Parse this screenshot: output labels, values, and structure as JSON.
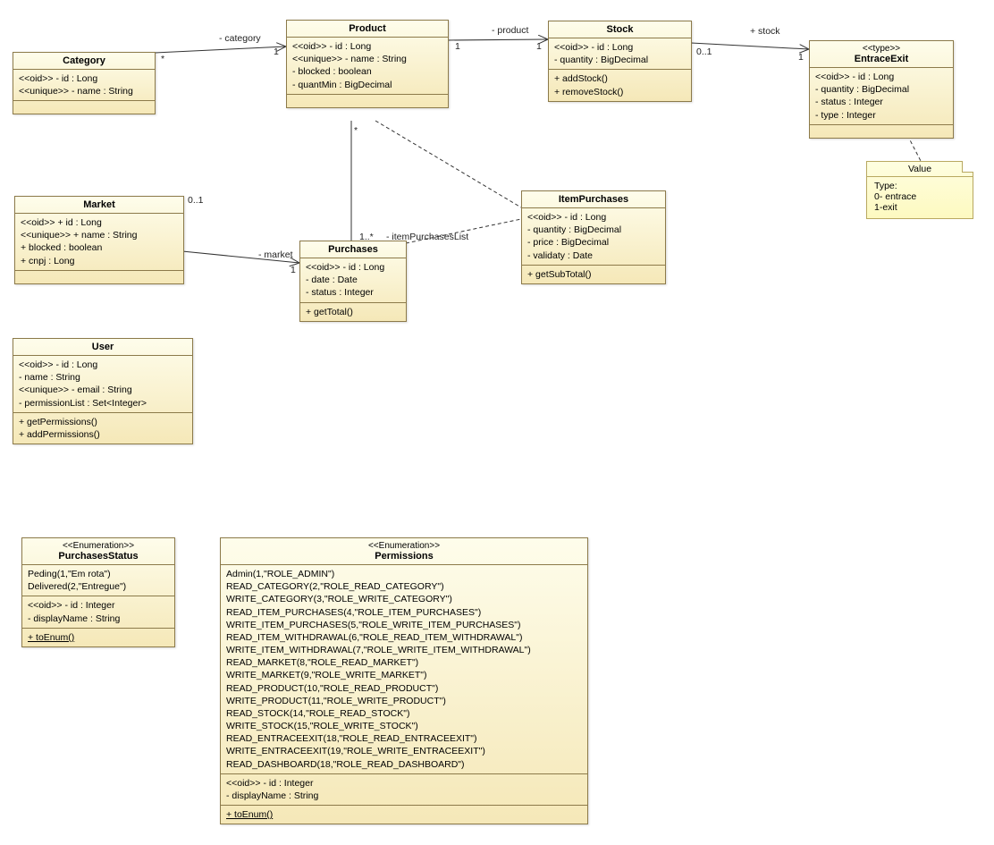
{
  "category": {
    "title": "Category",
    "attr1": "<<oid>> - id : Long",
    "attr2": "<<unique>> - name : String"
  },
  "product": {
    "title": "Product",
    "a1": "<<oid>> - id : Long",
    "a2": "<<unique>> - name : String",
    "a3": "- blocked : boolean",
    "a4": "- quantMin : BigDecimal"
  },
  "stock": {
    "title": "Stock",
    "a1": "<<oid>> - id : Long",
    "a2": "- quantity : BigDecimal",
    "m1": "+ addStock()",
    "m2": "+ removeStock()"
  },
  "entraceexit": {
    "stereo": "<<type>>",
    "title": "EntraceExit",
    "a1": "<<oid>> - id : Long",
    "a2": "- quantity : BigDecimal",
    "a3": "- status : Integer",
    "a4": "- type : Integer"
  },
  "market": {
    "title": "Market",
    "a1": "<<oid>> + id : Long",
    "a2": "<<unique>> + name : String",
    "a3": "+ blocked : boolean",
    "a4": "+ cnpj : Long"
  },
  "purchases": {
    "title": "Purchases",
    "a1": "<<oid>> - id : Long",
    "a2": "- date : Date",
    "a3": "- status : Integer",
    "m1": "+ getTotal()"
  },
  "itempurchases": {
    "title": "ItemPurchases",
    "a1": "<<oid>> - id : Long",
    "a2": "- quantity : BigDecimal",
    "a3": "- price : BigDecimal",
    "a4": "- validaty : Date",
    "m1": "+ getSubTotal()"
  },
  "user": {
    "title": "User",
    "a1": "<<oid>> - id : Long",
    "a2": "- name : String",
    "a3": "<<unique>> - email : String",
    "a4": "- permissionList : Set<Integer>",
    "m1": "+ getPermissions()",
    "m2": "+ addPermissions()"
  },
  "purchasesstatus": {
    "stereo": "<<Enumeration>>",
    "title": "PurchasesStatus",
    "v1": "Peding(1,\"Em rota\")",
    "v2": "Delivered(2,\"Entregue\")",
    "a1": "<<oid>> - id : Integer",
    "a2": "- displayName : String",
    "m1": "+ toEnum()"
  },
  "permissions": {
    "stereo": "<<Enumeration>>",
    "title": "Permissions",
    "v1": "Admin(1,\"ROLE_ADMIN\")",
    "v2": "READ_CATEGORY(2,\"ROLE_READ_CATEGORY\")",
    "v3": "WRITE_CATEGORY(3,\"ROLE_WRITE_CATEGORY\")",
    "v4": "READ_ITEM_PURCHASES(4,\"ROLE_ITEM_PURCHASES\")",
    "v5": "WRITE_ITEM_PURCHASES(5,\"ROLE_WRITE_ITEM_PURCHASES\")",
    "v6": "READ_ITEM_WITHDRAWAL(6,\"ROLE_READ_ITEM_WITHDRAWAL\")",
    "v7": "WRITE_ITEM_WITHDRAWAL(7,\"ROLE_WRITE_ITEM_WITHDRAWAL\")",
    "v8": "READ_MARKET(8,\"ROLE_READ_MARKET\")",
    "v9": "WRITE_MARKET(9,\"ROLE_WRITE_MARKET\")",
    "v10": "READ_PRODUCT(10,\"ROLE_READ_PRODUCT\")",
    "v11": "WRITE_PRODUCT(11,\"ROLE_WRITE_PRODUCT\")",
    "v12": "READ_STOCK(14,\"ROLE_READ_STOCK\")",
    "v13": "WRITE_STOCK(15,\"ROLE_WRITE_STOCK\")",
    "v14": "READ_ENTRACEEXIT(18,\"ROLE_READ_ENTRACEEXIT\")",
    "v15": "WRITE_ENTRACEEXIT(19,\"ROLE_WRITE_ENTRACEEXIT\")",
    "v16": "READ_DASHBOARD(18,\"ROLE_READ_DASHBOARD\")",
    "a1": "<<oid>> - id : Integer",
    "a2": "- displayName : String",
    "m1": "+ toEnum()"
  },
  "note": {
    "title": "Value",
    "l1": "Type:",
    "l2": "0- entrace",
    "l3": "1-exit"
  },
  "labels": {
    "category_role": "- category",
    "star": "*",
    "one": "1",
    "product_role": "- product",
    "zero_one": "0..1",
    "plus_stock": "+ stock",
    "market_role": "- market",
    "one_star": "1..*",
    "item_list": "- itemPurchasesList"
  }
}
